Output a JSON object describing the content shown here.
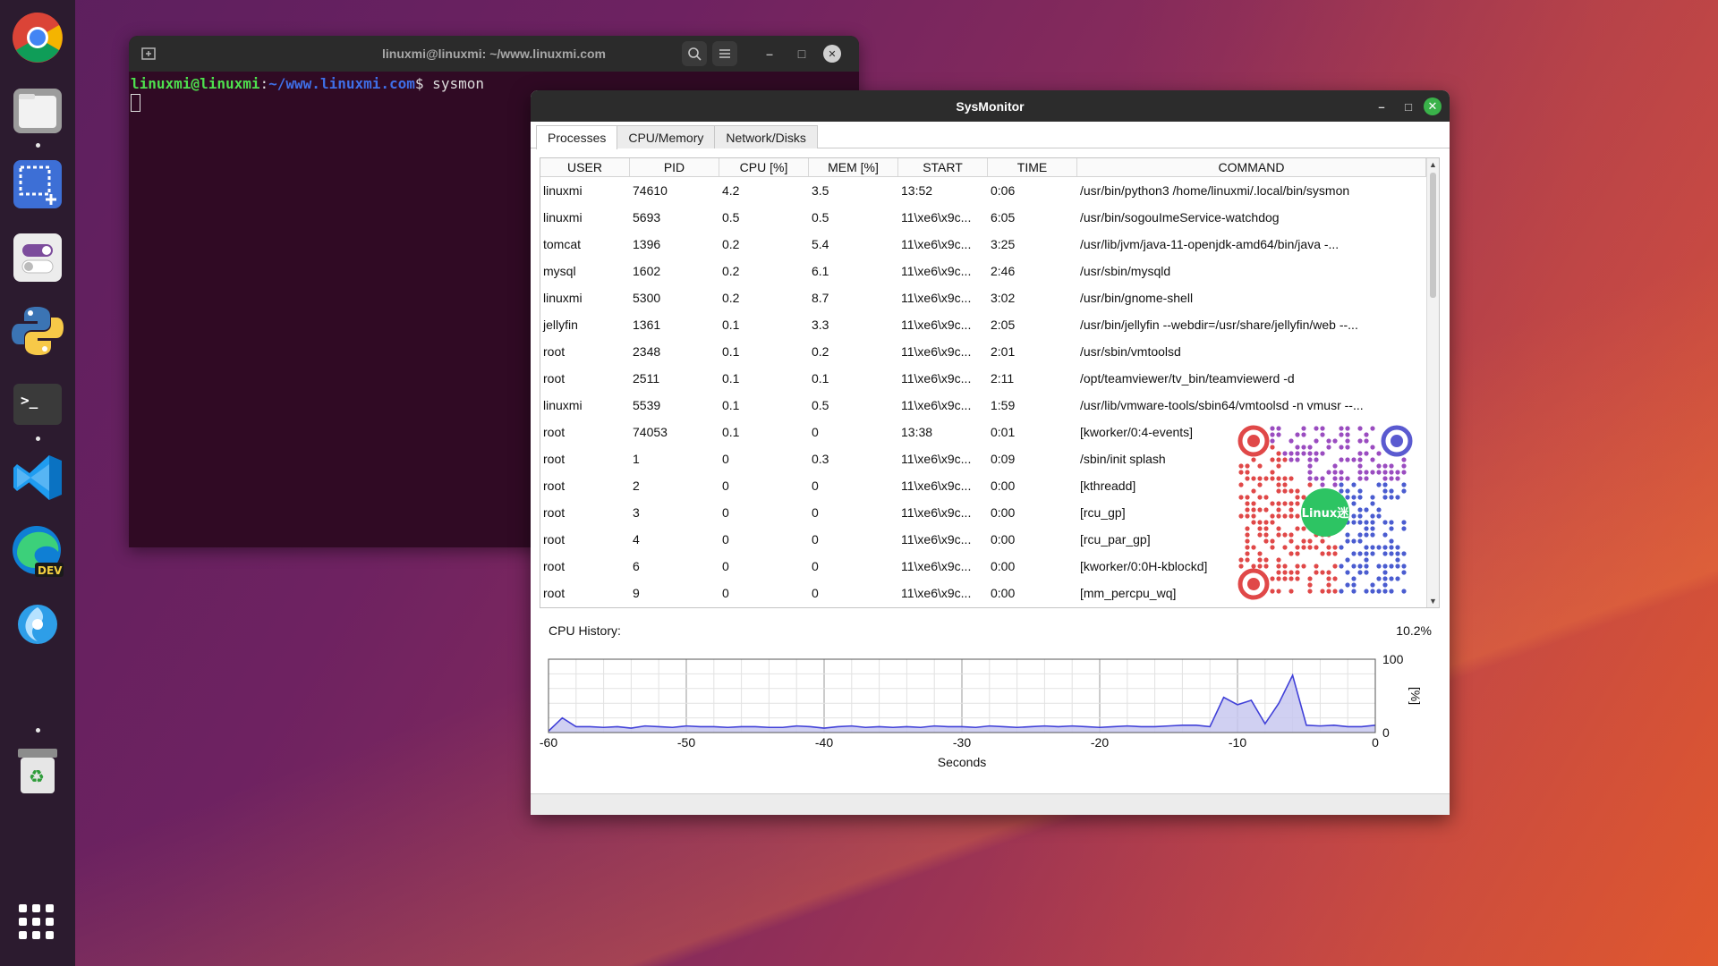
{
  "dock": {
    "items": [
      {
        "name": "chrome-icon"
      },
      {
        "name": "files-icon"
      },
      {
        "name": "screenshot-icon"
      },
      {
        "name": "settings-toggle-icon"
      },
      {
        "name": "python-icon"
      },
      {
        "name": "terminal-icon",
        "glyph": ">_"
      },
      {
        "name": "vscode-icon"
      },
      {
        "name": "edge-dev-icon",
        "badge": "DEV"
      },
      {
        "name": "deepin-icon"
      },
      {
        "name": "trash-icon",
        "glyph": "♻"
      }
    ],
    "apps_grid_icon": "apps-grid-icon"
  },
  "terminal": {
    "title": "linuxmi@linuxmi: ~/www.linuxmi.com",
    "prompt_user": "linuxmi@linuxmi",
    "prompt_sep": ":",
    "prompt_path": "~/www.linuxmi.com",
    "prompt_symbol": "$",
    "command": " sysmon",
    "controls": {
      "minimize": "–",
      "maximize": "□",
      "close": "✕"
    }
  },
  "sysmon": {
    "title": "SysMonitor",
    "controls": {
      "minimize": "–",
      "maximize": "□",
      "close": "✕"
    },
    "tabs": [
      {
        "label": "Processes",
        "active": true
      },
      {
        "label": "CPU/Memory",
        "active": false
      },
      {
        "label": "Network/Disks",
        "active": false
      }
    ],
    "columns": [
      "USER",
      "PID",
      "CPU [%]",
      "MEM [%]",
      "START",
      "TIME",
      "COMMAND"
    ],
    "rows": [
      [
        "linuxmi",
        "74610",
        "4.2",
        "3.5",
        "13:52",
        "0:06",
        "/usr/bin/python3 /home/linuxmi/.local/bin/sysmon"
      ],
      [
        "linuxmi",
        "5693",
        "0.5",
        "0.5",
        "11\\xe6\\x9c...",
        "6:05",
        "/usr/bin/sogouImeService-watchdog"
      ],
      [
        "tomcat",
        "1396",
        "0.2",
        "5.4",
        "11\\xe6\\x9c...",
        "3:25",
        "/usr/lib/jvm/java-11-openjdk-amd64/bin/java -..."
      ],
      [
        "mysql",
        "1602",
        "0.2",
        "6.1",
        "11\\xe6\\x9c...",
        "2:46",
        "/usr/sbin/mysqld"
      ],
      [
        "linuxmi",
        "5300",
        "0.2",
        "8.7",
        "11\\xe6\\x9c...",
        "3:02",
        "/usr/bin/gnome-shell"
      ],
      [
        "jellyfin",
        "1361",
        "0.1",
        "3.3",
        "11\\xe6\\x9c...",
        "2:05",
        "/usr/bin/jellyfin --webdir=/usr/share/jellyfin/web --..."
      ],
      [
        "root",
        "2348",
        "0.1",
        "0.2",
        "11\\xe6\\x9c...",
        "2:01",
        "/usr/sbin/vmtoolsd"
      ],
      [
        "root",
        "2511",
        "0.1",
        "0.1",
        "11\\xe6\\x9c...",
        "2:11",
        "/opt/teamviewer/tv_bin/teamviewerd -d"
      ],
      [
        "linuxmi",
        "5539",
        "0.1",
        "0.5",
        "11\\xe6\\x9c...",
        "1:59",
        "/usr/lib/vmware-tools/sbin64/vmtoolsd -n vmusr --..."
      ],
      [
        "root",
        "74053",
        "0.1",
        "0",
        "13:38",
        "0:01",
        "[kworker/0:4-events]"
      ],
      [
        "root",
        "1",
        "0",
        "0.3",
        "11\\xe6\\x9c...",
        "0:09",
        "/sbin/init splash"
      ],
      [
        "root",
        "2",
        "0",
        "0",
        "11\\xe6\\x9c...",
        "0:00",
        "[kthreadd]"
      ],
      [
        "root",
        "3",
        "0",
        "0",
        "11\\xe6\\x9c...",
        "0:00",
        "[rcu_gp]"
      ],
      [
        "root",
        "4",
        "0",
        "0",
        "11\\xe6\\x9c...",
        "0:00",
        "[rcu_par_gp]"
      ],
      [
        "root",
        "6",
        "0",
        "0",
        "11\\xe6\\x9c...",
        "0:00",
        "[kworker/0:0H-kblockd]"
      ],
      [
        "root",
        "9",
        "0",
        "0",
        "11\\xe6\\x9c...",
        "0:00",
        "[mm_percpu_wq]"
      ]
    ],
    "cpu_history_label": "CPU History:",
    "cpu_history_value": "10.2%",
    "qr_logo_text": "Linux迷"
  },
  "chart_data": {
    "type": "area",
    "title": "",
    "xlabel": "Seconds",
    "ylabel": "[%]",
    "xlim": [
      -60,
      0
    ],
    "ylim": [
      0,
      100
    ],
    "xticks": [
      "-60",
      "-50",
      "-40",
      "-30",
      "-20",
      "-10",
      "0"
    ],
    "yticks": [
      "100",
      "0"
    ],
    "grid": true,
    "colors": {
      "line": "#4040d8",
      "fill": "#c8c8f0"
    },
    "x": [
      -60,
      -59,
      -58,
      -57,
      -56,
      -55,
      -54,
      -53,
      -52,
      -51,
      -50,
      -49,
      -48,
      -47,
      -46,
      -45,
      -44,
      -43,
      -42,
      -41,
      -40,
      -39,
      -38,
      -37,
      -36,
      -35,
      -34,
      -33,
      -32,
      -31,
      -30,
      -29,
      -28,
      -27,
      -26,
      -25,
      -24,
      -23,
      -22,
      -21,
      -20,
      -19,
      -18,
      -17,
      -16,
      -15,
      -14,
      -13,
      -12,
      -11,
      -10,
      -9,
      -8,
      -7,
      -6,
      -5,
      -4,
      -3,
      -2,
      -1,
      0
    ],
    "values": [
      2,
      20,
      8,
      8,
      7,
      8,
      6,
      9,
      8,
      7,
      9,
      8,
      8,
      7,
      8,
      8,
      7,
      7,
      9,
      8,
      6,
      8,
      9,
      7,
      8,
      7,
      8,
      7,
      9,
      8,
      8,
      7,
      9,
      8,
      7,
      8,
      9,
      8,
      9,
      8,
      7,
      8,
      9,
      8,
      8,
      9,
      10,
      10,
      8,
      48,
      38,
      44,
      12,
      40,
      78,
      10,
      9,
      10,
      8,
      8,
      10
    ]
  }
}
